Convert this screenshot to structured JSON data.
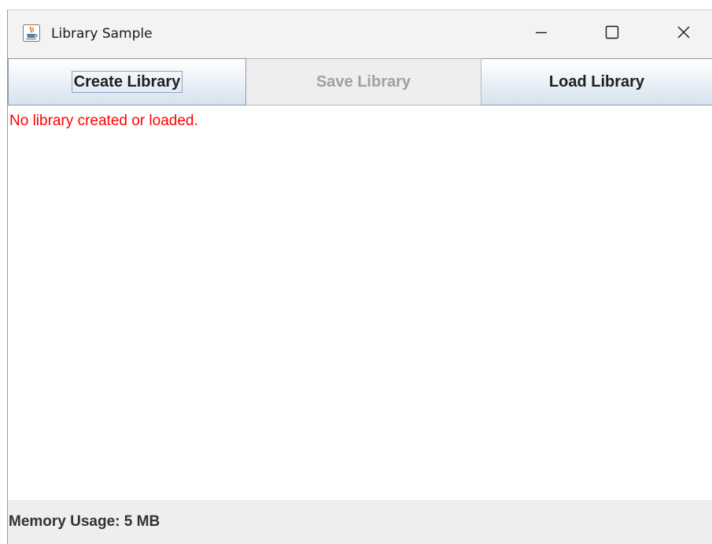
{
  "window": {
    "title": "Library Sample",
    "app_icon": "java-cup-icon",
    "controls": {
      "minimize_icon": "minimize-icon",
      "maximize_icon": "maximize-icon",
      "close_icon": "close-icon"
    }
  },
  "toolbar": {
    "create_label": "Create Library",
    "save_label": "Save Library",
    "save_enabled": false,
    "load_label": "Load Library"
  },
  "content": {
    "status_message": "No library created or loaded.",
    "status_color": "#ff0000"
  },
  "footer": {
    "memory_label": "Memory Usage: 5 MB"
  }
}
